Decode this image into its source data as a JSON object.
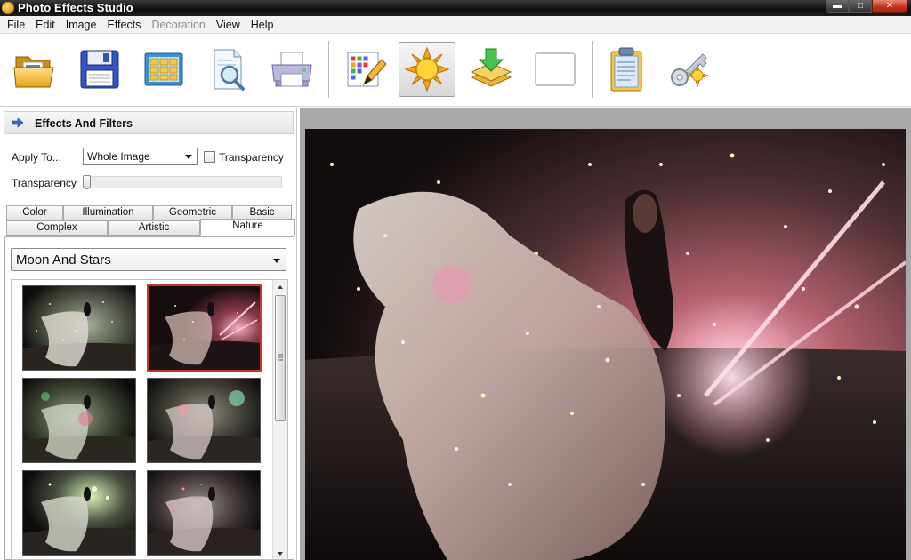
{
  "window": {
    "title": "Photo Effects Studio",
    "controls": {
      "minimize": "▬",
      "maximize": "□",
      "close": "✕"
    }
  },
  "menu": [
    {
      "label": "File",
      "enabled": true
    },
    {
      "label": "Edit",
      "enabled": true
    },
    {
      "label": "Image",
      "enabled": true
    },
    {
      "label": "Effects",
      "enabled": true
    },
    {
      "label": "Decoration",
      "enabled": false
    },
    {
      "label": "View",
      "enabled": true
    },
    {
      "label": "Help",
      "enabled": true
    }
  ],
  "toolbar": {
    "tools": [
      {
        "icon": "open-folder-icon"
      },
      {
        "icon": "save-disk-icon"
      },
      {
        "icon": "grid-icon"
      },
      {
        "icon": "document-search-icon"
      },
      {
        "icon": "printer-icon"
      },
      {
        "icon": "grid-pencil-icon"
      },
      {
        "icon": "sun-icon",
        "active": true
      },
      {
        "icon": "layers-download-icon"
      },
      {
        "icon": "blank-frame-icon"
      },
      {
        "icon": "clipboard-icon"
      },
      {
        "icon": "key-sun-icon"
      }
    ]
  },
  "panel": {
    "title": "Effects And Filters",
    "apply_to_label": "Apply To...",
    "apply_to_value": "Whole Image",
    "transparency_checkbox_label": "Transparency",
    "transparency_checked": false,
    "transparency_slider_label": "Transparency",
    "transparency_level": 0,
    "tabs_row1": [
      "Color",
      "Illumination",
      "Geometric",
      "Basic"
    ],
    "tabs_row2": [
      "Complex",
      "Artistic",
      "Nature"
    ],
    "selected_tab": "Nature",
    "effect_value": "Moon And Stars",
    "selected_thumbnail": 1,
    "thumbnail_scroll_position": 0
  },
  "colors": {
    "titlebar": "#111111",
    "selection_border": "#c0392b",
    "canvas_background": "#a9a9a9"
  }
}
